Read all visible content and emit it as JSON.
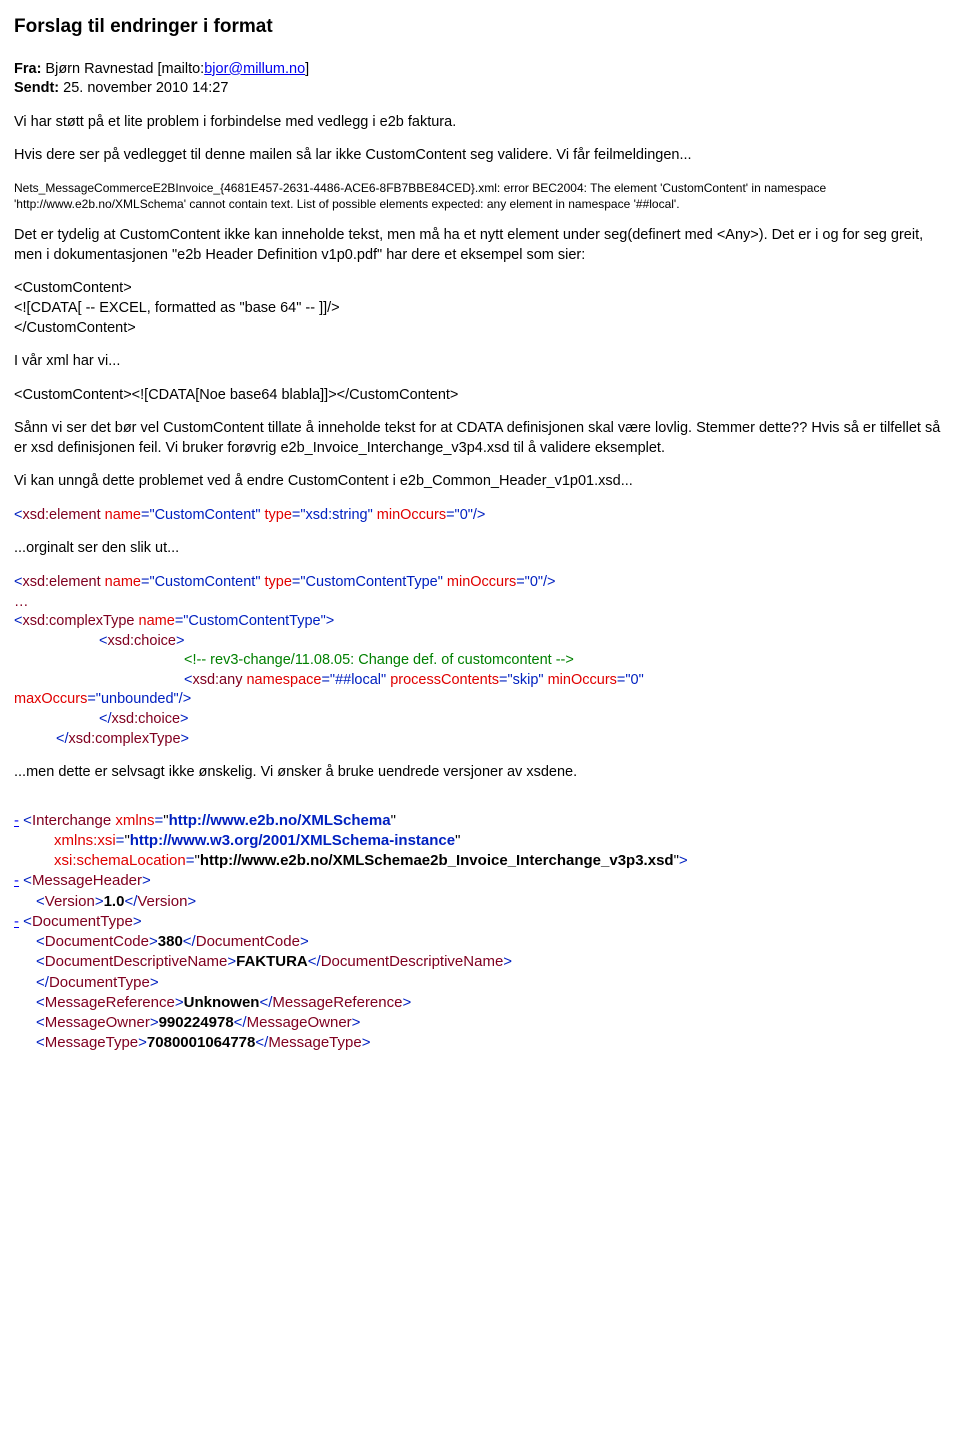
{
  "title": "Forslag til endringer i format",
  "from_label": "Fra:",
  "from_name": " Bjørn Ravnestad ",
  "from_mail_prefix": "[mailto:",
  "from_mail": "bjor@millum.no",
  "from_mail_suffix": "]",
  "sent_label": "Sendt:",
  "sent_value": " 25. november 2010 14:27",
  "p1": "Vi har støtt på et lite problem i forbindelse med vedlegg i e2b faktura.",
  "p2": "Hvis dere ser på vedlegget til denne mailen så lar ikke CustomContent seg validere. Vi får feilmeldingen...",
  "err": "Nets_MessageCommerceE2BInvoice_{4681E457-2631-4486-ACE6-8FB7BBE84CED}.xml: error BEC2004: The element 'CustomContent' in namespace 'http://www.e2b.no/XMLSchema' cannot contain text. List of possible elements expected: any element in namespace '##local'.",
  "p3": "Det er tydelig at CustomContent ikke kan inneholde tekst, men må ha et nytt element under seg(definert med <Any>). Det er i og for seg greit, men i dokumentasjonen \"e2b Header Definition v1p0.pdf\" har dere et eksempel som sier:",
  "cc_open": "<CustomContent>",
  "cc_cdata": "<![CDATA[ -- EXCEL, formatted as \"base 64\" -- ]]/>",
  "cc_close": "</CustomContent>",
  "p4": "I vår xml har vi...",
  "cc_oneline": "<CustomContent><![CDATA[Noe base64 blabla]]></CustomContent>",
  "p5": "Sånn vi ser det bør vel CustomContent tillate å inneholde tekst for at CDATA definisjonen skal være lovlig. Stemmer dette?? Hvis så er tilfellet så er xsd definisjonen feil. Vi bruker forøvrig e2b_Invoice_Interchange_v3p4.xsd til å validere eksemplet.",
  "p6": "Vi kan unngå dette problemet ved å endre CustomContent i e2b_Common_Header_v1p01.xsd...",
  "xsd1": {
    "lt": "<",
    "elem": "xsd:element",
    "name_attr": " name",
    "eq": "=",
    "name_val": "\"CustomContent\"",
    "type_attr": " type",
    "type_val": "\"xsd:string\"",
    "min_attr": " minOccurs",
    "min_val": "\"0\"",
    "close": "/>"
  },
  "p7": "...orginalt ser den slik ut...",
  "xsd2": {
    "type_val": "\"CustomContentType\""
  },
  "dots": "…",
  "ct_open_elem": "xsd:complexType",
  "ct_name_val": "\"CustomContentType\"",
  "choice": "xsd:choice",
  "comment": "<!-- rev3-change/11.08.05: Change def. of customcontent -->",
  "any_elem": "xsd:any",
  "ns_attr": " namespace",
  "ns_val": "\"##local\"",
  "pc_attr": " processContents",
  "pc_val": "\"skip\"",
  "max_attr": "maxOccurs",
  "max_val": "\"unbounded\"",
  "p8": "...men dette er selvsagt ikke ønskelig. Vi ønsker å bruke uendrede versjoner av xsdene.",
  "tree": {
    "interchange": "Interchange",
    "xmlns": " xmlns",
    "xmlns_val": "http://www.e2b.no/XMLSchema",
    "xmlnsxsi": "xmlns:xsi",
    "xsi_val": "http://www.w3.org/2001/XMLSchema-instance",
    "schemaloc": "xsi:schemaLocation",
    "schemaloc_val": "http://www.e2b.no/XMLSchemae2b_Invoice_Interchange_v3p3.xsd",
    "msgheader": "MessageHeader",
    "version": "Version",
    "version_val": "1.0",
    "doctype": "DocumentType",
    "doccode": "DocumentCode",
    "doccode_val": "380",
    "docdesc": "DocumentDescriptiveName",
    "docdesc_val": "FAKTURA",
    "msgref": "MessageReference",
    "msgref_val": "Unknowen",
    "msgowner": "MessageOwner",
    "msgowner_val": "990224978",
    "msgtype": "MessageType",
    "msgtype_val": "7080001064778"
  }
}
